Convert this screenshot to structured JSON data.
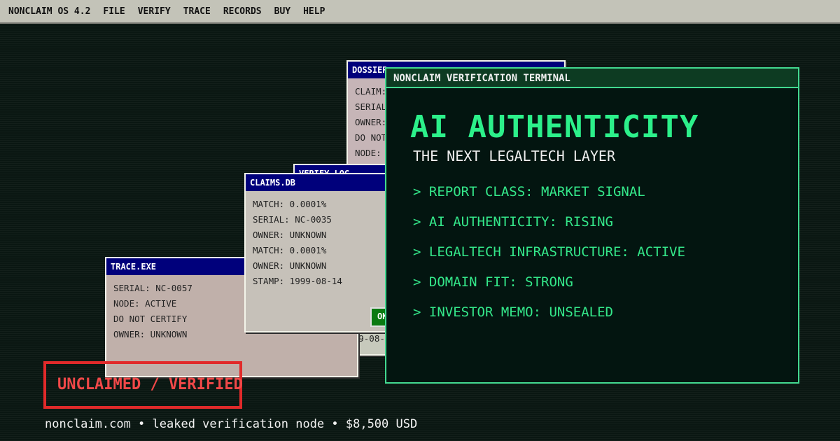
{
  "menubar": {
    "brand": "NONCLAIM OS 4.2",
    "items": [
      "FILE",
      "VERIFY",
      "TRACE",
      "RECORDS",
      "BUY",
      "HELP"
    ]
  },
  "dossier": {
    "title": "DOSSIER",
    "rows": [
      "CLAIM:",
      "SERIAL",
      "OWNER:",
      "DO NOT",
      "NODE:"
    ]
  },
  "verify_log": {
    "title": "VERIFY.LOG",
    "stamp": "STAMP: 1999-08-"
  },
  "claims_db": {
    "title": "CLAIMS.DB",
    "rows": [
      "MATCH: 0.0001%",
      "SERIAL: NC-0035",
      "OWNER: UNKNOWN",
      "MATCH: 0.0001%",
      "OWNER: UNKNOWN",
      "STAMP: 1999-08-14"
    ],
    "ok_label": "OK"
  },
  "trace_exe": {
    "title": "TRACE.EXE",
    "rows": [
      "SERIAL: NC-0057",
      "NODE: ACTIVE",
      "DO NOT CERTIFY",
      "OWNER: UNKNOWN"
    ]
  },
  "terminal": {
    "title": "NONCLAIM VERIFICATION TERMINAL",
    "headline": "AI AUTHENTICITY",
    "subheadline": "THE NEXT LEGALTECH LAYER",
    "lines": [
      "> REPORT CLASS: MARKET SIGNAL",
      "> AI AUTHENTICITY: RISING",
      "> LEGALTECH INFRASTRUCTURE: ACTIVE",
      "> DOMAIN FIT: STRONG",
      "> INVESTOR MEMO: UNSEALED"
    ]
  },
  "badge": {
    "text": "UNCLAIMED / VERIFIED"
  },
  "footer": {
    "text": "nonclaim.com • leaked verification node • $8,500 USD"
  },
  "colors": {
    "terminal_green": "#2cf08a",
    "title_bar_blue": "#00007b",
    "badge_red": "#e12a2a"
  }
}
